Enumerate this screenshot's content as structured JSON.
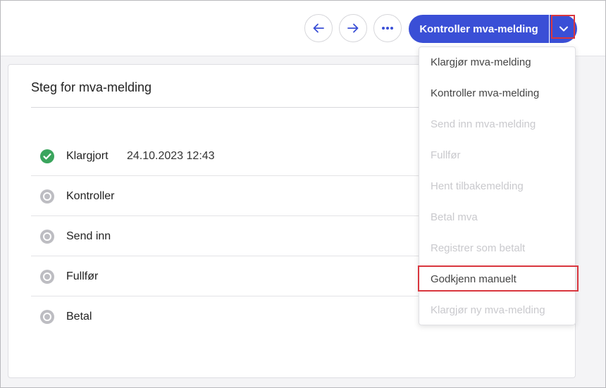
{
  "toolbar": {
    "primary_label": "Kontroller mva-melding"
  },
  "card": {
    "title": "Steg for mva-melding",
    "steps": [
      {
        "label": "Klargjort",
        "timestamp": "24.10.2023 12:43",
        "status": "done"
      },
      {
        "label": "Kontroller",
        "status": "pending"
      },
      {
        "label": "Send inn",
        "status": "pending"
      },
      {
        "label": "Fullfør",
        "status": "pending"
      },
      {
        "label": "Betal",
        "status": "pending"
      }
    ]
  },
  "menu": {
    "items": [
      {
        "label": "Klargjør mva-melding",
        "enabled": true
      },
      {
        "label": "Kontroller mva-melding",
        "enabled": true
      },
      {
        "label": "Send inn mva-melding",
        "enabled": false
      },
      {
        "label": "Fullfør",
        "enabled": false
      },
      {
        "label": "Hent tilbakemelding",
        "enabled": false
      },
      {
        "label": "Betal mva",
        "enabled": false
      },
      {
        "label": "Registrer som betalt",
        "enabled": false
      },
      {
        "label": "Godkjenn manuelt",
        "enabled": true,
        "highlighted": true
      },
      {
        "label": "Klargjør ny mva-melding",
        "enabled": false
      }
    ]
  },
  "colors": {
    "primary": "#3a4fd6",
    "success": "#3aa55d",
    "pending": "#bdbdc2",
    "highlight": "#d9363e"
  }
}
